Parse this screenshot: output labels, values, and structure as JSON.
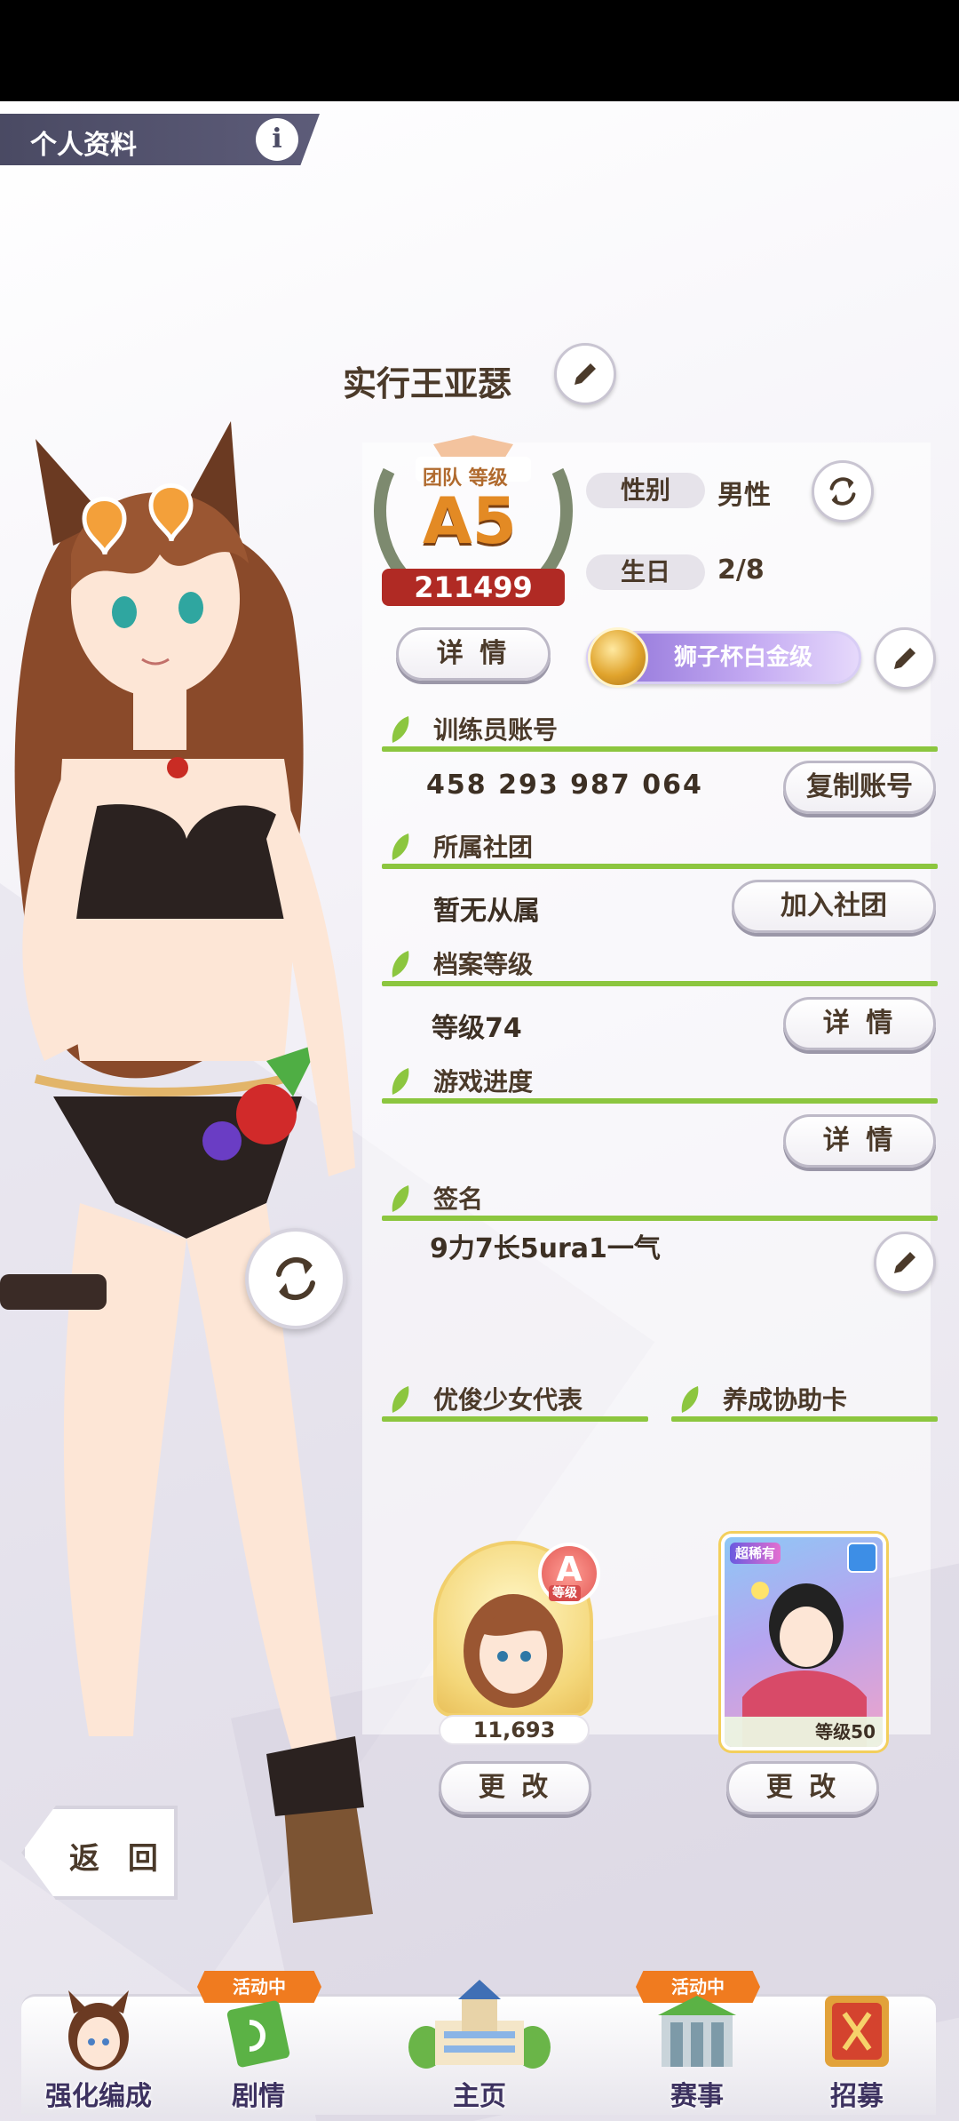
{
  "header": {
    "title": "个人资料",
    "info_icon": "i"
  },
  "profile": {
    "trainer_name": "实行王亚瑟",
    "rank_caption": "团队 等级",
    "rank": "A5",
    "rank_score": "211499",
    "gender_label": "性别",
    "gender_value": "男性",
    "birthday_label": "生日",
    "birthday_value": "2/8",
    "details_button": "详 情",
    "title_badge": "狮子杯白金级"
  },
  "sections": {
    "account": {
      "label": "训练员账号",
      "value": "458 293 987 064",
      "button": "复制账号"
    },
    "club": {
      "label": "所属社团",
      "value": "暂无从属",
      "button": "加入社团"
    },
    "profile_level": {
      "label": "档案等级",
      "value": "等级74",
      "button": "详 情"
    },
    "progress": {
      "label": "游戏进度",
      "button": "详 情"
    },
    "signature": {
      "label": "签名",
      "value": "9力7长5ura1一气"
    }
  },
  "representative": {
    "label": "优俊少女代表",
    "rank": "A",
    "rank_caption": "等级",
    "score": "11,693",
    "button": "更 改"
  },
  "support_card": {
    "label": "养成协助卡",
    "rarity": "超稀有",
    "level": "等级50",
    "button": "更 改"
  },
  "back_button": "返 回",
  "nav": {
    "items": [
      {
        "label": "强化编成",
        "icon": "horse-girl-portrait-icon"
      },
      {
        "label": "剧情",
        "icon": "story-book-icon",
        "tag": "活动中"
      },
      {
        "label": "主页",
        "icon": "school-building-icon"
      },
      {
        "label": "赛事",
        "icon": "race-gate-icon",
        "tag": "活动中"
      },
      {
        "label": "招募",
        "icon": "gacha-door-icon"
      }
    ]
  },
  "colors": {
    "accent_green": "#8cc63f",
    "text_brown": "#4b3a2a",
    "header_bg": "#4a4a63",
    "tag_orange": "#f07b1f"
  }
}
